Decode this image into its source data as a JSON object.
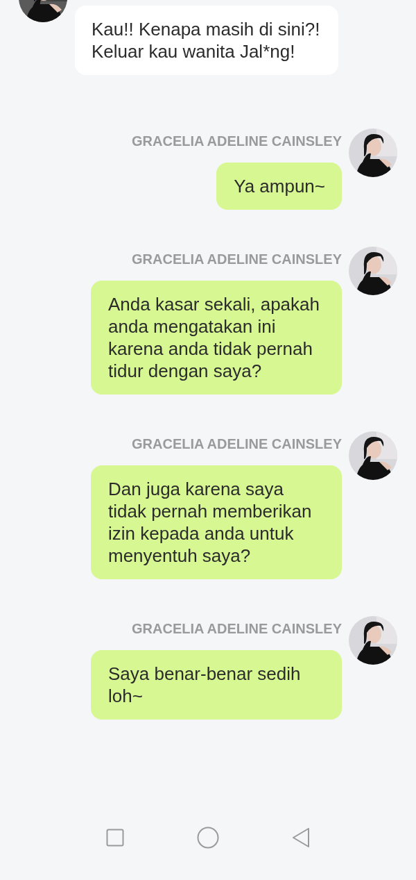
{
  "messages": [
    {
      "kind": "incoming",
      "text": "Kau!! Kenapa masih di sini?! Keluar kau wanita Jal*ng!"
    },
    {
      "kind": "outgoing",
      "sender": "GRACELIA ADELINE CAINSLEY",
      "text": "Ya ampun~"
    },
    {
      "kind": "outgoing",
      "sender": "GRACELIA ADELINE CAINSLEY",
      "text": "Anda kasar sekali, apakah anda mengatakan ini karena anda tidak pernah tidur dengan saya?"
    },
    {
      "kind": "outgoing",
      "sender": "GRACELIA ADELINE CAINSLEY",
      "text": "Dan juga karena saya tidak pernah memberikan izin kepada anda untuk menyentuh saya?"
    },
    {
      "kind": "outgoing",
      "sender": "GRACELIA ADELINE CAINSLEY",
      "text": "Saya benar-benar sedih loh~"
    }
  ]
}
